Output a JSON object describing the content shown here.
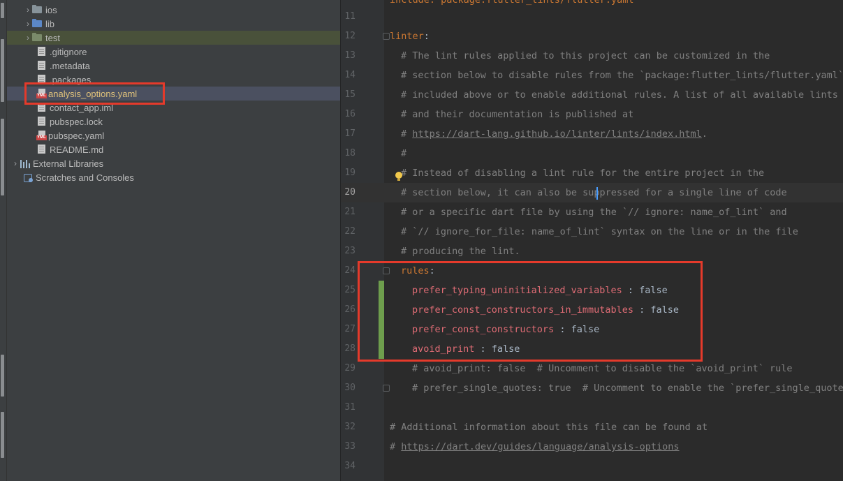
{
  "project_tree": {
    "items": [
      {
        "label": "ios",
        "type": "folder",
        "expandable": true
      },
      {
        "label": "lib",
        "type": "folder",
        "expandable": true
      },
      {
        "label": "test",
        "type": "folder",
        "expandable": true
      },
      {
        "label": ".gitignore",
        "type": "file"
      },
      {
        "label": ".metadata",
        "type": "file"
      },
      {
        "label": ".packages",
        "type": "file"
      },
      {
        "label": "analysis_options.yaml",
        "type": "yaml",
        "selected": true
      },
      {
        "label": "contact_app.iml",
        "type": "file"
      },
      {
        "label": "pubspec.lock",
        "type": "file"
      },
      {
        "label": "pubspec.yaml",
        "type": "yaml"
      },
      {
        "label": "README.md",
        "type": "file"
      },
      {
        "label": "External Libraries",
        "type": "libraries",
        "expandable": true
      },
      {
        "label": "Scratches and Consoles",
        "type": "scratches"
      }
    ],
    "icon_tag": "YML"
  },
  "editor": {
    "current_line": 20,
    "lines": [
      {
        "n": "11",
        "text": ""
      },
      {
        "n": "12",
        "key": "linter",
        "suffix": ":"
      },
      {
        "n": "13",
        "comment": "# The lint rules applied to this project can be customized in the"
      },
      {
        "n": "14",
        "comment": "# section below to disable rules from the `package:flutter_lints/flutter.yaml`"
      },
      {
        "n": "15",
        "comment": "# included above or to enable additional rules. A list of all available lints"
      },
      {
        "n": "16",
        "comment": "# and their documentation is published at"
      },
      {
        "n": "17",
        "comment": "# ",
        "link": "https://dart-lang.github.io/linter/lints/index.html",
        "after": "."
      },
      {
        "n": "18",
        "comment": "#"
      },
      {
        "n": "19",
        "comment": "# Instead of disabling a lint rule for the entire project in the"
      },
      {
        "n": "20",
        "comment": "# section below, it can also be suppressed for a single line of code"
      },
      {
        "n": "21",
        "comment": "# or a specific dart file by using the `// ignore: name_of_lint` and"
      },
      {
        "n": "22",
        "comment": "# `// ignore_for_file: name_of_lint` syntax on the line or in the file"
      },
      {
        "n": "23",
        "comment": "# producing the lint."
      },
      {
        "n": "24",
        "key": "rules",
        "suffix": ":"
      },
      {
        "n": "25",
        "rule": "prefer_typing_uninitialized_variables",
        "value": " : false"
      },
      {
        "n": "26",
        "rule": "prefer_const_constructors_in_immutables",
        "value": " : false"
      },
      {
        "n": "27",
        "rule": "prefer_const_constructors",
        "value": " : false"
      },
      {
        "n": "28",
        "rule": "avoid_print",
        "value": " : false"
      },
      {
        "n": "29",
        "comment": "# avoid_print: false  # Uncomment to disable the `avoid_print` rule"
      },
      {
        "n": "30",
        "comment": "# prefer_single_quotes: true  # Uncomment to enable the `prefer_single_quotes`"
      },
      {
        "n": "31",
        "text": ""
      },
      {
        "n": "32",
        "comment": "# Additional information about this file can be found at"
      },
      {
        "n": "33",
        "comment": "# ",
        "link": "https://dart.dev/guides/language/analysis-options"
      },
      {
        "n": "34",
        "text": ""
      }
    ],
    "top_partial": "include: package:flutter_lints/flutter.yaml"
  },
  "colors": {
    "highlight_box": "#e53a2b",
    "comment": "#808080",
    "rule_key": "#e06c75",
    "top_key": "#cc7832",
    "change_marker": "#6e9e4d"
  }
}
